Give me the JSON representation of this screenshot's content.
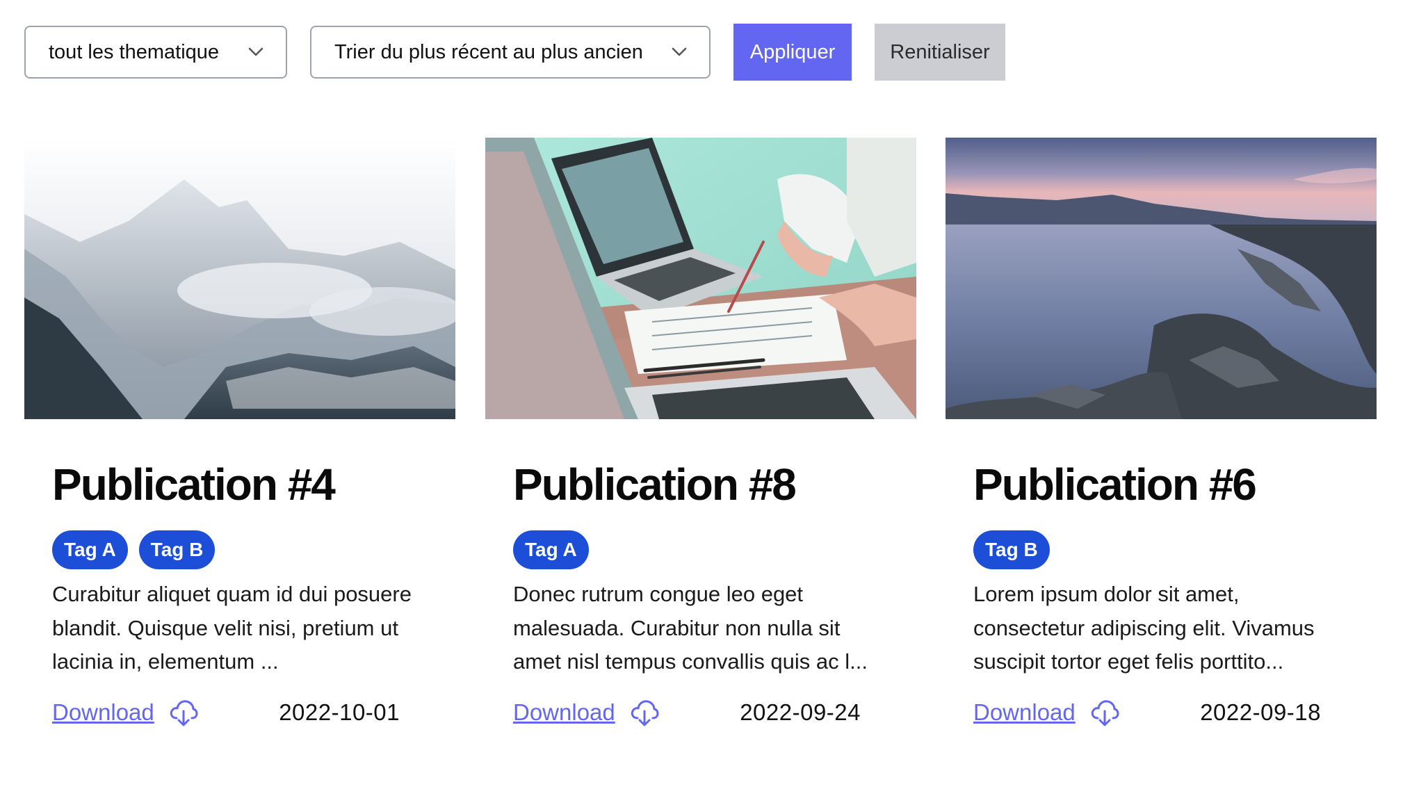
{
  "filters": {
    "theme_value": "tout les thematique",
    "sort_value": "Trier du plus récent au plus ancien",
    "apply_label": "Appliquer",
    "reset_label": "Renitialiser"
  },
  "cards": [
    {
      "title": "Publication #4",
      "tags": [
        "Tag A",
        "Tag B"
      ],
      "description": "Curabitur aliquet quam id dui posuere blandit. Quisque velit nisi, pretium ut lacinia in, elementum ...",
      "download_label": "Download",
      "date": "2022-10-01"
    },
    {
      "title": "Publication #8",
      "tags": [
        "Tag A"
      ],
      "description": "Donec rutrum congue leo eget malesuada. Curabitur non nulla sit amet nisl tempus convallis quis ac l...",
      "download_label": "Download",
      "date": "2022-09-24"
    },
    {
      "title": "Publication #6",
      "tags": [
        "Tag B"
      ],
      "description": "Lorem ipsum dolor sit amet, consectetur adipiscing elit. Vivamus suscipit tortor eget felis porttito...",
      "download_label": "Download",
      "date": "2022-09-18"
    }
  ],
  "colors": {
    "accent": "#6366f1",
    "tag": "#1d4ed8",
    "reset_bg": "#cbcdd2"
  },
  "icons": {
    "select_arrow": "chevron-down-icon",
    "download": "cloud-download-icon"
  }
}
